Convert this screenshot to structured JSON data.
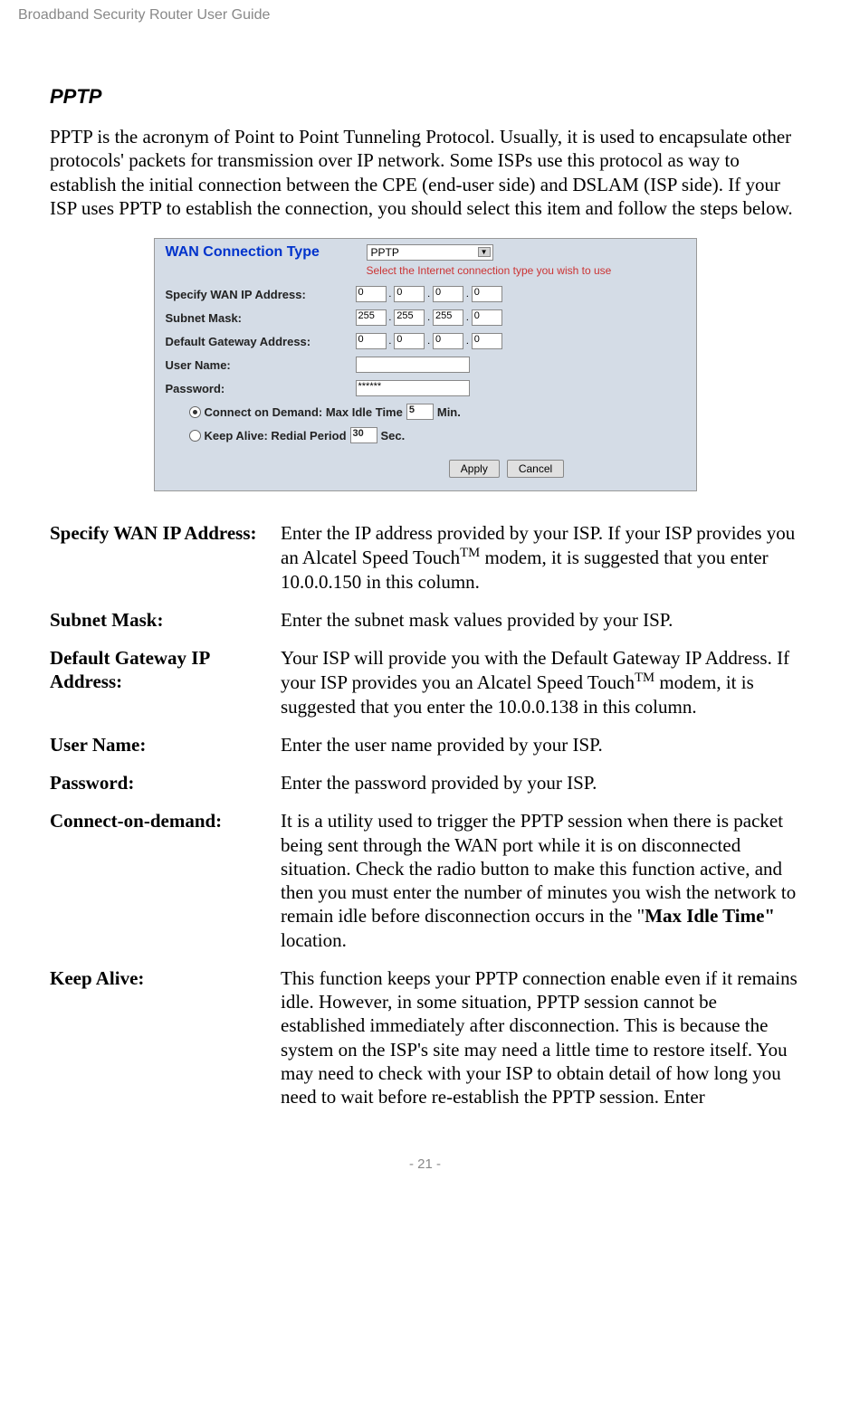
{
  "header": "Broadband Security Router User Guide",
  "section_title": "PPTP",
  "intro": "PPTP is the acronym of Point to Point Tunneling Protocol. Usually, it is used to encapsulate other protocols' packets for transmission over IP network. Some ISPs use this protocol as way to establish the initial connection between the CPE (end-user side) and DSLAM (ISP side). If your ISP uses PPTP to establish the connection, you should select this item and follow the steps below.",
  "screenshot": {
    "wan_title": "WAN Connection Type",
    "wan_select": "PPTP",
    "wan_hint": "Select the Internet connection type you wish to use",
    "rows": {
      "wan_ip_label": "Specify WAN IP Address:",
      "wan_ip": [
        "0",
        "0",
        "0",
        "0"
      ],
      "subnet_label": "Subnet Mask:",
      "subnet": [
        "255",
        "255",
        "255",
        "0"
      ],
      "gateway_label": "Default Gateway Address:",
      "gateway": [
        "0",
        "0",
        "0",
        "0"
      ],
      "user_label": "User Name:",
      "user_value": "",
      "pass_label": "Password:",
      "pass_value": "******",
      "radio1_pre": "Connect on Demand: Max Idle Time",
      "radio1_val": "5",
      "radio1_suf": "Min.",
      "radio2_pre": "Keep Alive: Redial Period",
      "radio2_val": "30",
      "radio2_suf": "Sec."
    },
    "btn_apply": "Apply",
    "btn_cancel": "Cancel"
  },
  "defs": {
    "d1_label": "Specify WAN IP Address:",
    "d1_pre": "Enter the IP address provided by your ISP. If your ISP provides you an Alcatel Speed Touch",
    "d1_tm": "TM",
    "d1_post": " modem, it is suggested that you enter 10.0.0.150 in this column.",
    "d2_label": "Subnet Mask:",
    "d2_text": "Enter the subnet mask values provided by your ISP.",
    "d3_label": "Default Gateway IP Address:",
    "d3_pre": "Your ISP will provide you with the Default Gateway IP Address. If your ISP provides you an Alcatel Speed Touch",
    "d3_tm": "TM",
    "d3_post": " modem, it is suggested that you enter the 10.0.0.138 in this column.",
    "d4_label": "User Name:",
    "d4_text": "Enter the user name provided by your ISP.",
    "d5_label": "Password:",
    "d5_text": "Enter the password provided by your ISP.",
    "d6_label": "Connect-on-demand:",
    "d6_pre": "It is a utility used to trigger the PPTP session when there is packet being sent through the WAN port while it is on disconnected situation. Check the radio button to make this function active, and then you must enter the number of minutes you wish the network to remain idle before disconnection occurs in the \"",
    "d6_bold": "Max Idle Time\"",
    "d6_post": " location.",
    "d7_label": "Keep Alive:",
    "d7_text": "This function keeps your PPTP connection enable even if it remains idle. However, in some situation, PPTP session cannot be established immediately after disconnection. This is because the system on the ISP's site may need a little time to restore itself. You may need to check with your ISP to obtain detail of how long you need to wait before re-establish the PPTP session. Enter"
  },
  "footer": "- 21 -"
}
